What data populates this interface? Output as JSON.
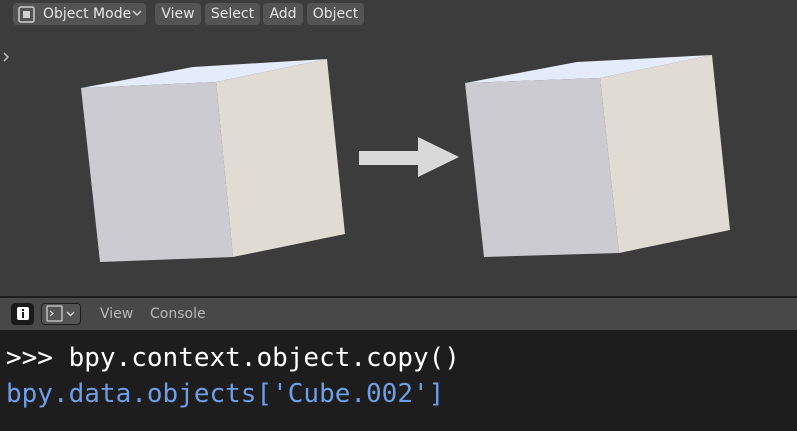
{
  "viewport": {
    "header": {
      "mode_label": "Object Mode",
      "menus": [
        {
          "label": "View"
        },
        {
          "label": "Select"
        },
        {
          "label": "Add"
        },
        {
          "label": "Object"
        }
      ]
    },
    "sidebar_toggle_icon": "chevron-right-icon",
    "scene": {
      "left_object": "cube",
      "right_object": "cube",
      "arrow": "arrow-right"
    }
  },
  "console": {
    "header": {
      "info_icon": "info-icon",
      "editor_type_icon": "python-console-icon",
      "menus": [
        {
          "label": "View"
        },
        {
          "label": "Console"
        }
      ]
    },
    "lines": [
      {
        "prompt": ">>> ",
        "text": "bpy.context.object.copy()"
      },
      {
        "text": "bpy.data.objects['Cube.002']"
      }
    ]
  },
  "colors": {
    "input_text": "#ffffff",
    "output_text": "#6f9ee8",
    "viewport_bg": "#3c3c3c",
    "console_bg": "#1d1d1d"
  }
}
